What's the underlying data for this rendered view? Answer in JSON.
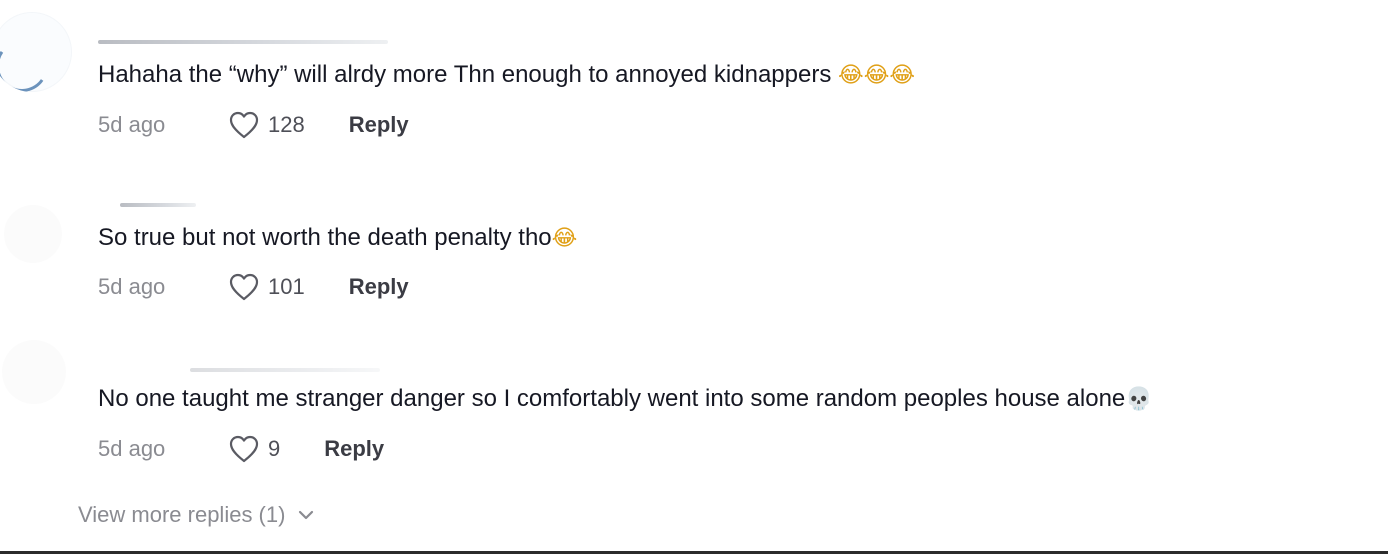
{
  "comments": [
    {
      "text": "Hahaha the “why” will alrdy more Thn enough to annoyed kidnappers",
      "emoji": "😂😂😂",
      "timestamp": "5d ago",
      "likes": "128",
      "reply_label": "Reply"
    },
    {
      "text": "So true but not worth the death penalty tho",
      "emoji": "😂",
      "timestamp": "5d ago",
      "likes": "101",
      "reply_label": "Reply"
    },
    {
      "text": "No one taught me stranger danger so I comfortably went into some random peoples house alone",
      "emoji": "💀",
      "timestamp": "5d ago",
      "likes": "9",
      "reply_label": "Reply"
    }
  ],
  "view_more_label": "View more replies (1)",
  "icons": {
    "like": "heart-outline-icon",
    "expand": "chevron-down-icon"
  },
  "colors": {
    "text": "#161823",
    "muted": "#8a8b91",
    "reply": "#3b3c44",
    "background": "#ffffff"
  }
}
